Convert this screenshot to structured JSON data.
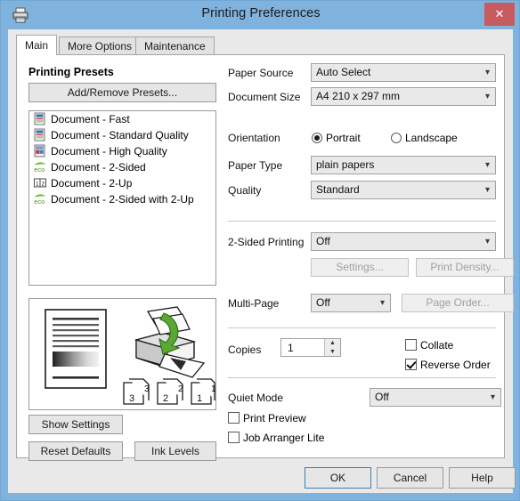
{
  "window": {
    "title": "Printing Preferences",
    "titlebar_icon": "printer-icon",
    "close_label": "✕",
    "frame_color": "#7fb2dd",
    "accent_close_color": "#c75b5f"
  },
  "tabs": [
    {
      "id": "main",
      "label": "Main",
      "active": true
    },
    {
      "id": "more-options",
      "label": "More Options",
      "active": false
    },
    {
      "id": "maintenance",
      "label": "Maintenance",
      "active": false
    }
  ],
  "left": {
    "presets_heading": "Printing Presets",
    "add_remove_label": "Add/Remove Presets...",
    "presets": [
      {
        "label": "Document - Fast",
        "icon": "document-preset-icon"
      },
      {
        "label": "Document - Standard Quality",
        "icon": "document-preset-icon"
      },
      {
        "label": "Document - High Quality",
        "icon": "document-hq-preset-icon"
      },
      {
        "label": "Document - 2-Sided",
        "icon": "eco-icon"
      },
      {
        "label": "Document - 2-Up",
        "icon": "two-up-icon"
      },
      {
        "label": "Document - 2-Sided with 2-Up",
        "icon": "eco-icon"
      }
    ],
    "preview": {
      "page_labels": [
        "3",
        "2",
        "1"
      ],
      "arrow_color": "#5aa832"
    },
    "show_settings_label": "Show Settings",
    "reset_defaults_label": "Reset Defaults",
    "ink_levels_label": "Ink Levels"
  },
  "right": {
    "paper_source": {
      "label": "Paper Source",
      "value": "Auto Select"
    },
    "document_size": {
      "label": "Document Size",
      "value": "A4 210 x 297 mm"
    },
    "orientation": {
      "label": "Orientation",
      "portrait_label": "Portrait",
      "landscape_label": "Landscape",
      "selected": "Portrait"
    },
    "paper_type": {
      "label": "Paper Type",
      "value": "plain papers"
    },
    "quality": {
      "label": "Quality",
      "value": "Standard"
    },
    "two_sided": {
      "label": "2-Sided Printing",
      "value": "Off",
      "settings_label": "Settings...",
      "print_density_label": "Print Density...",
      "settings_enabled": false,
      "print_density_enabled": false
    },
    "multi_page": {
      "label": "Multi-Page",
      "value": "Off",
      "page_order_label": "Page Order...",
      "page_order_enabled": false
    },
    "copies": {
      "label": "Copies",
      "value": "1"
    },
    "collate": {
      "label": "Collate",
      "checked": false
    },
    "reverse_order": {
      "label": "Reverse Order",
      "checked": true
    },
    "quiet_mode": {
      "label": "Quiet Mode",
      "value": "Off"
    },
    "print_preview": {
      "label": "Print Preview",
      "checked": false
    },
    "job_arranger": {
      "label": "Job Arranger Lite",
      "checked": false
    }
  },
  "footer": {
    "ok_label": "OK",
    "cancel_label": "Cancel",
    "help_label": "Help"
  }
}
